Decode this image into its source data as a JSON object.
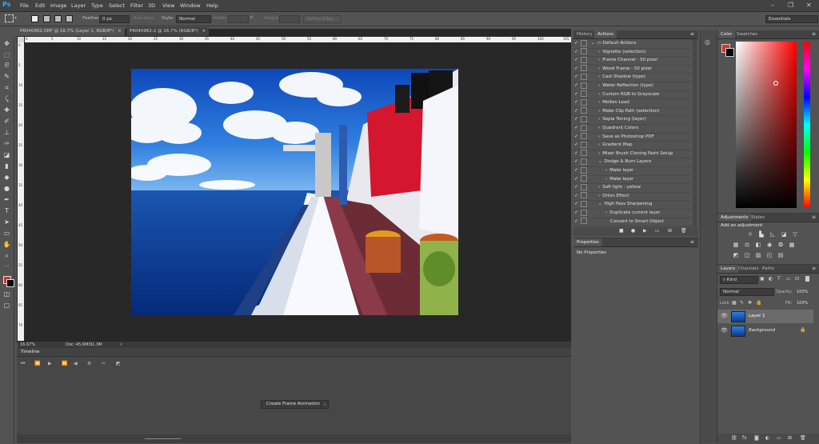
{
  "app": {
    "logo": "Ps"
  },
  "menu": [
    "File",
    "Edit",
    "Image",
    "Layer",
    "Type",
    "Select",
    "Filter",
    "3D",
    "View",
    "Window",
    "Help"
  ],
  "window_controls": {
    "minimize": "–",
    "restore": "❐",
    "close": "✕"
  },
  "options_bar": {
    "feather_label": "Feather:",
    "feather_value": "0 px",
    "antialias_label": "Anti-alias",
    "style_label": "Style:",
    "style_value": "Normal",
    "width_label": "Width:",
    "height_label": "Height:",
    "refine_edge": "Refine Edge...",
    "workspace": "Essentials"
  },
  "tabs": [
    {
      "label": "P6040962.ORF @ 16.7% (Layer 1, RGB/8*)",
      "close": "×"
    },
    {
      "label": "P6040962-2 @ 16.7% (RGB/8*)",
      "close": "×"
    }
  ],
  "ruler_h": [
    "0",
    "5",
    "10",
    "15",
    "20",
    "25",
    "30",
    "35",
    "40",
    "45",
    "50",
    "55",
    "60",
    "65",
    "70",
    "75",
    "80",
    "85",
    "90",
    "95",
    "100",
    "105"
  ],
  "ruler_v": [
    "0",
    "5",
    "10",
    "15",
    "20",
    "25",
    "30",
    "35",
    "40",
    "45",
    "50",
    "55",
    "60",
    "65",
    "70"
  ],
  "status": {
    "zoom": "16.67%",
    "doc": "Doc: 45.6M/91.3M",
    "arrow": "›"
  },
  "timeline": {
    "title": "Timeline",
    "create_button": "Create Frame Animation",
    "dropdown": "⌄"
  },
  "history_actions": {
    "tab_history": "History",
    "tab_actions": "Actions",
    "actions": [
      {
        "label": "Default Actions",
        "level": 0,
        "folder": true
      },
      {
        "label": "Vignette (selection)",
        "level": 1
      },
      {
        "label": "Frame Channel - 50 pixel",
        "level": 1
      },
      {
        "label": "Wood Frame - 50 pixel",
        "level": 1
      },
      {
        "label": "Cast Shadow (type)",
        "level": 1
      },
      {
        "label": "Water Reflection (type)",
        "level": 1
      },
      {
        "label": "Custom RGB to Grayscale",
        "level": 1
      },
      {
        "label": "Molten Lead",
        "level": 1
      },
      {
        "label": "Make Clip Path (selection)",
        "level": 1
      },
      {
        "label": "Sepia Toning (layer)",
        "level": 1
      },
      {
        "label": "Quadrant Colors",
        "level": 1
      },
      {
        "label": "Save as Photoshop PDF",
        "level": 1
      },
      {
        "label": "Gradient Map",
        "level": 1
      },
      {
        "label": "Mixer Brush Cloning Paint Setup",
        "level": 1
      },
      {
        "label": "Dodge & Burn Layers",
        "level": 1,
        "open": true
      },
      {
        "label": "Make layer",
        "level": 2
      },
      {
        "label": "Make layer",
        "level": 2
      },
      {
        "label": "Soft light - yellow",
        "level": 1
      },
      {
        "label": "Orton Effect",
        "level": 1
      },
      {
        "label": "High Pass Sharpening",
        "level": 1,
        "open": true
      },
      {
        "label": "Duplicate current layer",
        "level": 2
      },
      {
        "label": "Convert to Smart Object",
        "level": 3
      }
    ]
  },
  "properties": {
    "title": "Properties",
    "empty": "No Properties"
  },
  "color": {
    "tab_color": "Color",
    "tab_swatches": "Swatches",
    "fg": "#d9312c",
    "bg": "#000000"
  },
  "adjustments": {
    "tab_adjustments": "Adjustments",
    "tab_styles": "Styles",
    "hint": "Add an adjustment"
  },
  "layers": {
    "tab_layers": "Layers",
    "tab_channels": "Channels",
    "tab_paths": "Paths",
    "kind": "Kind",
    "blend": "Normal",
    "opacity_label": "Opacity:",
    "opacity_value": "100%",
    "lock_label": "Lock:",
    "fill_label": "Fill:",
    "fill_value": "100%",
    "items": [
      {
        "name": "Layer 1",
        "selected": true
      },
      {
        "name": "Background",
        "selected": false,
        "locked": true
      }
    ]
  }
}
